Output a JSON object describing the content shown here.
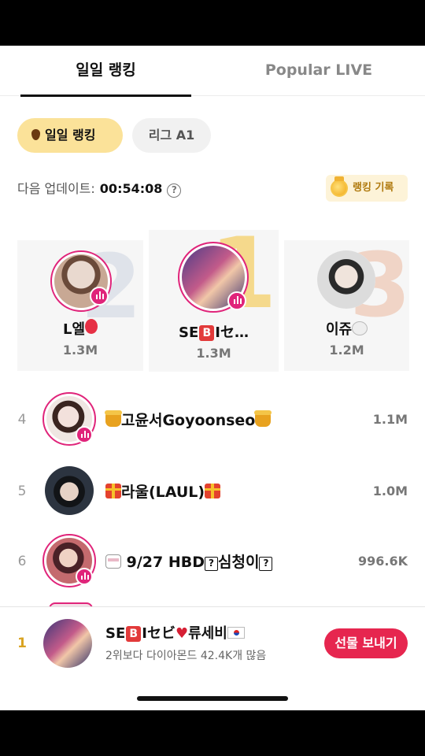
{
  "tabs": {
    "daily": "일일 랭킹",
    "live": "Popular LIVE"
  },
  "chips": {
    "daily": "일일 랭킹",
    "league": "리그 A1"
  },
  "update": {
    "label": "다음 업데이트:",
    "timer": "00:54:08",
    "help": "?"
  },
  "history_button": "랭킹 기록",
  "podium": [
    {
      "rank": "2",
      "name": "L엘",
      "score": "1.3M",
      "avatar_colors": [
        "#e9d9cf",
        "#c8a894"
      ]
    },
    {
      "rank": "1",
      "name_prefix": "SE",
      "name_box": "B",
      "name_suffix": "Iセ…",
      "score": "1.3M",
      "avatar_colors": [
        "#c35b8a",
        "#4a3a86"
      ]
    },
    {
      "rank": "3",
      "name": "이쥬",
      "score": "1.2M",
      "avatar_colors": [
        "#dcdcdc",
        "#6c6c6c"
      ]
    }
  ],
  "list": [
    {
      "rank": "4",
      "name": "고윤서Goyoonseo",
      "score": "1.1M",
      "avatar_colors": [
        "#f3e1dc",
        "#8a5a4c"
      ]
    },
    {
      "rank": "5",
      "name": "라울(LAUL)",
      "score": "1.0M",
      "avatar_colors": [
        "#2c3440",
        "#121417"
      ]
    },
    {
      "rank": "6",
      "name_a": "9/27 HBD",
      "name_b": "심청이",
      "box": "?",
      "score": "996.6K",
      "avatar_colors": [
        "#c46a6e",
        "#4a2127"
      ]
    }
  ],
  "my_rank": {
    "rank": "1",
    "name_prefix": "SE",
    "name_box": "B",
    "name_suffix": "Iセビ",
    "name_tail": "류세비",
    "subtitle": "2위보다 다이아몬드 42.4K개 많음",
    "button": "선물 보내기",
    "avatar_colors": [
      "#c35b8a",
      "#3a3578"
    ]
  },
  "colors": {
    "accent_pink": "#e0247a",
    "gift_red": "#e6264f",
    "chip_yellow": "#fbe299",
    "gold": "#d9a321"
  }
}
